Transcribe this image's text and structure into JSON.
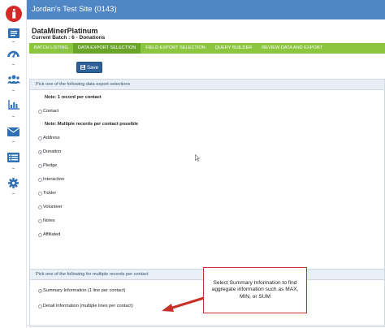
{
  "topbar": {
    "site_title": "Jordan's Test Site (0143)"
  },
  "header": {
    "app_name": "DataMinerPlatinum",
    "batch_label": "Current Batch : 6 - Donations"
  },
  "tabs": [
    {
      "label": "BATCH LISTING",
      "active": false
    },
    {
      "label": "DATA EXPORT SELECTION",
      "active": true
    },
    {
      "label": "FIELD EXPORT SELECTION",
      "active": false
    },
    {
      "label": "QUERY BUILDER",
      "active": false
    },
    {
      "label": "REVIEW DATA AND EXPORT",
      "active": false
    }
  ],
  "toolbar": {
    "save_label": "Save"
  },
  "export_panel": {
    "heading": "Pick one of the following data export selections",
    "note_single": "Note: 1 record per contact",
    "note_multiple": "Note: Multiple records per contact possible",
    "options": [
      {
        "label": "Contact",
        "checked": false
      },
      {
        "label": "Address",
        "checked": false
      },
      {
        "label": "Donation",
        "checked": true
      },
      {
        "label": "Pledge",
        "checked": false
      },
      {
        "label": "Interaction",
        "checked": false
      },
      {
        "label": "Tickler",
        "checked": false
      },
      {
        "label": "Volunteer",
        "checked": false
      },
      {
        "label": "Notes",
        "checked": false
      },
      {
        "label": "Affiliated",
        "checked": false
      }
    ]
  },
  "multi_panel": {
    "heading": "Pick one of the following for multiple records per contact",
    "options": [
      {
        "label": "Summary Information (1 line per contact)",
        "checked": true
      },
      {
        "label": "Detail Information (multiple lines per contact)",
        "checked": false
      }
    ]
  },
  "callout": {
    "text": "Select Summary Information to find aggregate information such as MAX, MIN, or SUM"
  },
  "colors": {
    "topbar": "#4f86c6",
    "tabs": "#8cc63f",
    "tab_active": "#6aa52a",
    "save_button": "#2d5f99",
    "logo": "#d42a26",
    "callout_border": "#c8302a",
    "sidebar_icons": "#2f6fb4"
  },
  "sidebar_icons": [
    "logo-icon",
    "dashboard-document-icon",
    "speedometer-icon",
    "people-icon",
    "bar-chart-icon",
    "envelope-icon",
    "list-icon",
    "gear-icon"
  ]
}
